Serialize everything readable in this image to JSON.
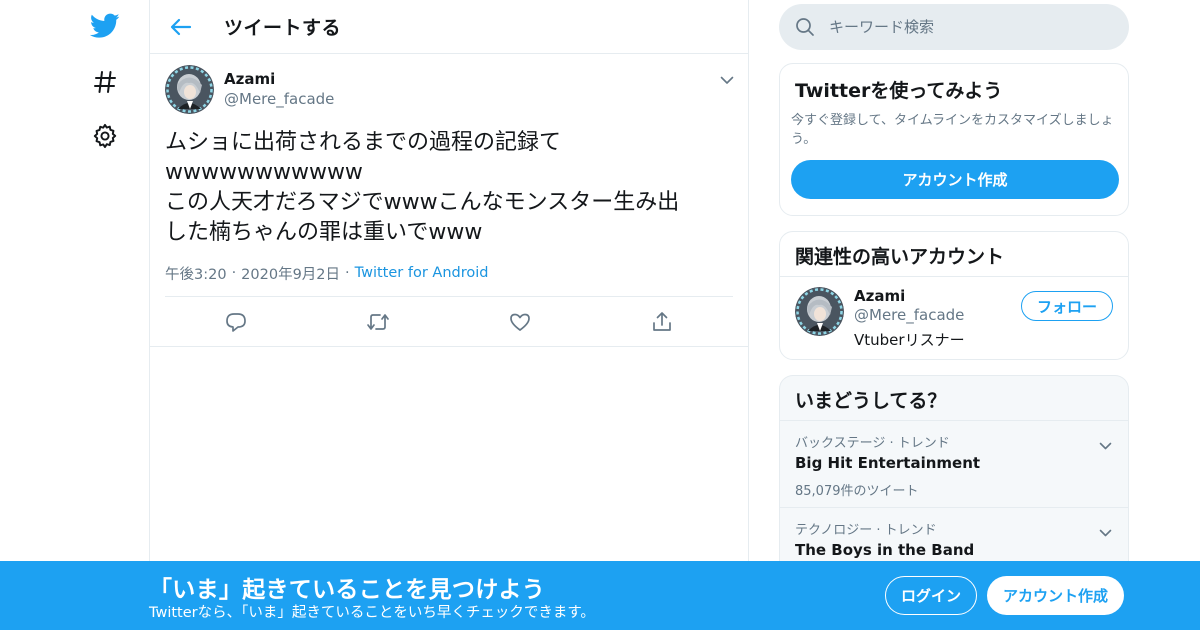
{
  "nav": {
    "items": [
      {
        "icon": "twitter-bird-icon"
      },
      {
        "icon": "hashtag-icon"
      },
      {
        "icon": "gear-icon"
      }
    ]
  },
  "header": {
    "title": "ツイートする"
  },
  "tweet": {
    "author_name": "Azami",
    "author_handle": "@Mere_facade",
    "text_lines": [
      "ムショに出荷されるまでの過程の記録て",
      "wwwwwwwwwww",
      "この人天才だろマジでwwwこんなモンスター生み出",
      "した楠ちゃんの罪は重いでwww"
    ],
    "time": "午後3:20",
    "date": "2020年9月2日",
    "source": "Twitter for Android",
    "separator": "·"
  },
  "search": {
    "placeholder": "キーワード検索"
  },
  "try_card": {
    "title": "Twitterを使ってみよう",
    "desc": "今すぐ登録して、タイムラインをカスタマイズしましょう。",
    "button": "アカウント作成"
  },
  "related_card": {
    "title": "関連性の高いアカウント",
    "name": "Azami",
    "handle": "@Mere_facade",
    "bio": "Vtuberリスナー",
    "follow": "フォロー"
  },
  "trends_card": {
    "title": "いまどうしてる？",
    "items": [
      {
        "meta": "バックステージ · トレンド",
        "name": "Big Hit Entertainment",
        "count": "85,079件のツイート"
      },
      {
        "meta": "テクノロジー · トレンド",
        "name": "The Boys in the Band",
        "count": ""
      }
    ]
  },
  "bottom_bar": {
    "title": "「いま」起きていることを見つけよう",
    "subtitle": "Twitterなら、「いま」起きていることをいち早くチェックできます。",
    "login": "ログイン",
    "signup": "アカウント作成"
  },
  "colors": {
    "accent": "#1da1f2",
    "secondary_text": "#657786",
    "border": "#e6ecf0"
  }
}
